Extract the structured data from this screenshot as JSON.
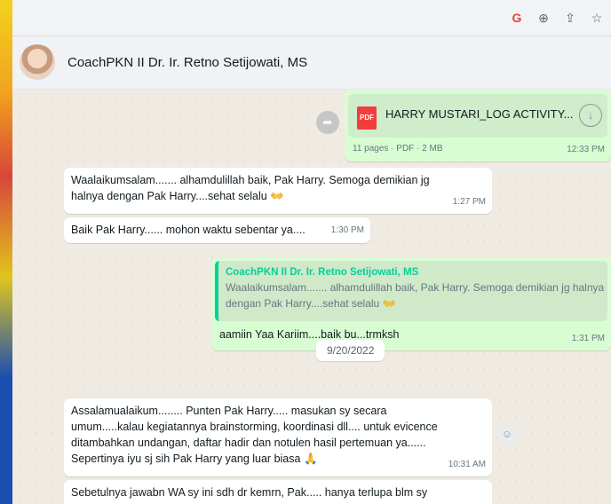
{
  "browser": {
    "icons": [
      "google-g-icon",
      "zoom-icon",
      "share-icon",
      "bookmark-star-icon"
    ],
    "g_glyph": "G"
  },
  "chat": {
    "contact_name": "CoachPKN II Dr. Ir. Retno Setijowati, MS",
    "document": {
      "file_badge": "PDF",
      "name": "HARRY MUSTARI_LOG ACTIVITY...",
      "meta": "11 pages · PDF · 2 MB",
      "time": "12:33 PM"
    },
    "messages": [
      {
        "line1": "Waalaikumsalam....... alhamdulillah baik, Pak Harry. Semoga demikian jg",
        "line2": "halnya dengan Pak Harry....sehat selalu",
        "emoji": "👐",
        "time": "1:27 PM"
      },
      {
        "text": "Baik Pak Harry...... mohon waktu sebentar ya....",
        "time": "1:30 PM"
      },
      {
        "quoted_author": "CoachPKN II Dr. Ir. Retno Setijowati, MS",
        "quoted_line1": "Waalaikumsalam....... alhamdulillah baik, Pak Harry. Semoga demikian jg halnya",
        "quoted_line2": "dengan Pak Harry....sehat selalu",
        "quoted_emoji": "👐",
        "text": "aamiin Yaa Kariim....baik bu...trmksh",
        "time": "1:31 PM"
      },
      {
        "line1": "Assalamualaikum........ Punten Pak Harry.....  masukan sy secara",
        "line2": "umum.....kalau kegiatannya brainstorming, koordinasi dll.... untuk evicence",
        "line3": "ditambahkan undangan, daftar hadir dan notulen hasil pertemuan ya......",
        "line4": "Sepertinya iyu sj sih Pak Harry yang luar biasa",
        "emoji": "🙏",
        "time": "10:31 AM"
      },
      {
        "text": "Sebetulnya jawabn WA sy ini sdh dr kemrn, Pak..... hanya terlupa blm sy"
      }
    ],
    "date_separator": "9/20/2022"
  }
}
